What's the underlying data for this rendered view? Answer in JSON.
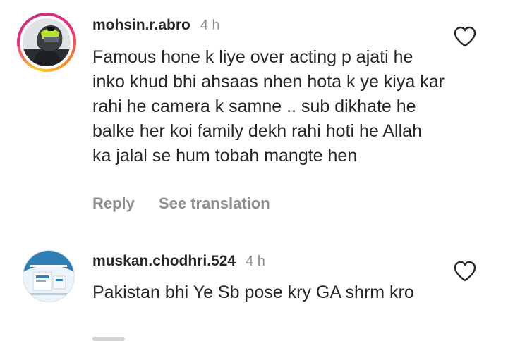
{
  "comments": [
    {
      "username": "mohsin.r.abro",
      "time": "4 h",
      "text": "Famous hone k liye over acting p ajati he inko khud bhi ahsaas nhen hota k ye kiya kar rahi he camera k samne .. sub dikhate he balke her koi family dekh rahi hoti he Allah ka jalal se hum tobah mangte hen",
      "reply_label": "Reply",
      "translate_label": "See translation",
      "avatar_icon": "helmet-rider-avatar",
      "has_story_ring": true
    },
    {
      "username": "muskan.chodhri.524",
      "time": "4 h",
      "text": "Pakistan bhi Ye Sb pose kry GA shrm kro",
      "avatar_icon": "product-box-avatar",
      "has_story_ring": false
    }
  ],
  "colors": {
    "text": "#262626",
    "secondary": "#8e8e8e",
    "ring_start": "#f9ce34",
    "ring_mid": "#ee2a7b",
    "ring_end": "#6228d7"
  }
}
